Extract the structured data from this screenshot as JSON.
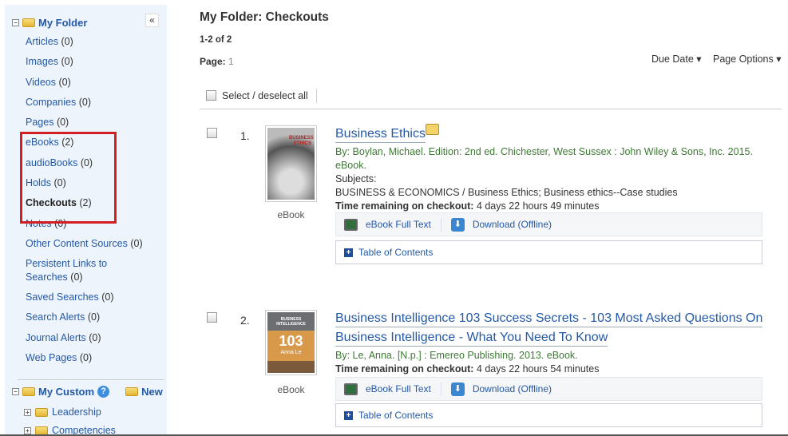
{
  "sidebar": {
    "folder_title": "My Folder",
    "collapse_label": "«",
    "items": [
      {
        "label": "Articles",
        "count": "(0)"
      },
      {
        "label": "Images",
        "count": "(0)"
      },
      {
        "label": "Videos",
        "count": "(0)"
      },
      {
        "label": "Companies",
        "count": "(0)"
      },
      {
        "label": "Pages",
        "count": "(0)"
      },
      {
        "label": "eBooks",
        "count": "(2)"
      },
      {
        "label": "audioBooks",
        "count": "(0)"
      },
      {
        "label": "Holds",
        "count": "(0)"
      },
      {
        "label": "Checkouts",
        "count": "(2)",
        "active": true
      },
      {
        "label": "Notes",
        "count": "(0)"
      },
      {
        "label": "Other Content Sources",
        "count": "(0)"
      },
      {
        "label": "Persistent Links to Searches",
        "count": "(0)"
      },
      {
        "label": "Saved Searches",
        "count": "(0)"
      },
      {
        "label": "Search Alerts",
        "count": "(0)"
      },
      {
        "label": "Journal Alerts",
        "count": "(0)"
      },
      {
        "label": "Web Pages",
        "count": "(0)"
      }
    ],
    "custom_title": "My Custom",
    "new_label": "New",
    "custom_folders": [
      "Leadership",
      "Competencies"
    ],
    "highlight_color": "#d21f24"
  },
  "main": {
    "title": "My Folder: Checkouts",
    "result_count": "1-2 of 2",
    "page_label": "Page:",
    "page_value": "1",
    "sort_label": "Due Date ▾",
    "page_options_label": "Page Options ▾",
    "select_all_label": "Select / deselect all",
    "records": [
      {
        "number": "1.",
        "title": "Business Ethics",
        "byline": "By: Boylan, Michael. Edition: 2nd ed. Chichester, West Sussex : John Wiley & Sons, Inc. 2015. eBook.",
        "subjects_label": "Subjects:",
        "subjects": "BUSINESS & ECONOMICS / Business Ethics; Business ethics--Case studies",
        "time_label": "Time remaining on checkout:",
        "time_value": "4 days 22 hours 49 minutes",
        "type": "eBook",
        "cover_text": "BUSINESS ETHICS"
      },
      {
        "number": "2.",
        "title_line1": "Business Intelligence 103 Success Secrets - 103 Most Asked Questions On",
        "title_line2": "Business Intelligence - What You Need To Know",
        "byline": "By: Le, Anna. [N.p.] : Emereo Publishing. 2013. eBook.",
        "time_label": "Time remaining on checkout:",
        "time_value": "4 days 22 hours 54 minutes",
        "type": "eBook",
        "cover_text": "BUSINESS INTELLIGENCE",
        "cover_num": "103",
        "cover_author": "Anna Le"
      }
    ],
    "full_text_label": "eBook Full Text",
    "download_label": "Download (Offline)",
    "toc_label": "Table of Contents"
  }
}
